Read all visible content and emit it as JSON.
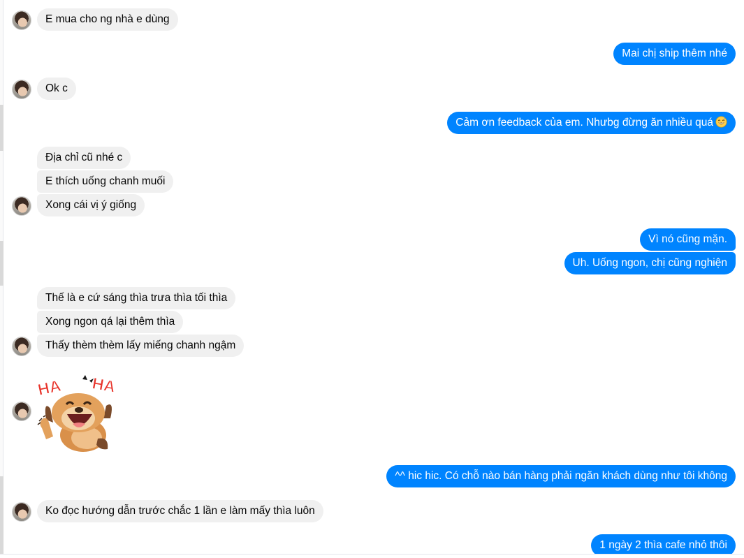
{
  "conversation": {
    "messages": [
      {
        "sender": "them",
        "text": "E mua cho ng nhà e dùng"
      },
      {
        "sender": "me",
        "text": "Mai chị ship thêm nhé"
      },
      {
        "sender": "them",
        "text": "Ok c"
      },
      {
        "sender": "me",
        "text": "Cảm ơn feedback của em. Nhưbg đừng ăn nhiều quá",
        "emoji": "grinning-sweat-emoji"
      },
      {
        "sender": "them",
        "text": "Địa chỉ cũ nhé c"
      },
      {
        "sender": "them",
        "text": "E thích uống chanh muối"
      },
      {
        "sender": "them",
        "text": "Xong cái vị ý giống"
      },
      {
        "sender": "me",
        "text": "Vì nó cũng mặn."
      },
      {
        "sender": "me",
        "text": "Uh. Uống ngon, chị cũng nghiện"
      },
      {
        "sender": "them",
        "text": "Thế là e cứ sáng thìa trưa thìa tối thìa"
      },
      {
        "sender": "them",
        "text": "Xong ngon qá lại thêm thìa"
      },
      {
        "sender": "them",
        "text": "Thấy thèm thèm lấy miếng chanh ngậm"
      },
      {
        "sender": "them",
        "sticker": "laughing-dog-sticker",
        "sticker_text": [
          "HA",
          "HA"
        ]
      },
      {
        "sender": "me",
        "text": "^^ hic hic. Có chỗ nào bán hàng phải ngăn khách dùng như tôi không"
      },
      {
        "sender": "them",
        "text": "Ko đọc hướng dẫn trước chắc 1 lần e làm mấy thìa luôn"
      },
      {
        "sender": "me",
        "text": "1 ngày 2 thìa cafe nhỏ thôi"
      }
    ]
  },
  "colors": {
    "outgoing_bubble": "#0084ff",
    "incoming_bubble": "#f0f0f0",
    "outgoing_text": "#ffffff",
    "incoming_text": "#050505"
  }
}
